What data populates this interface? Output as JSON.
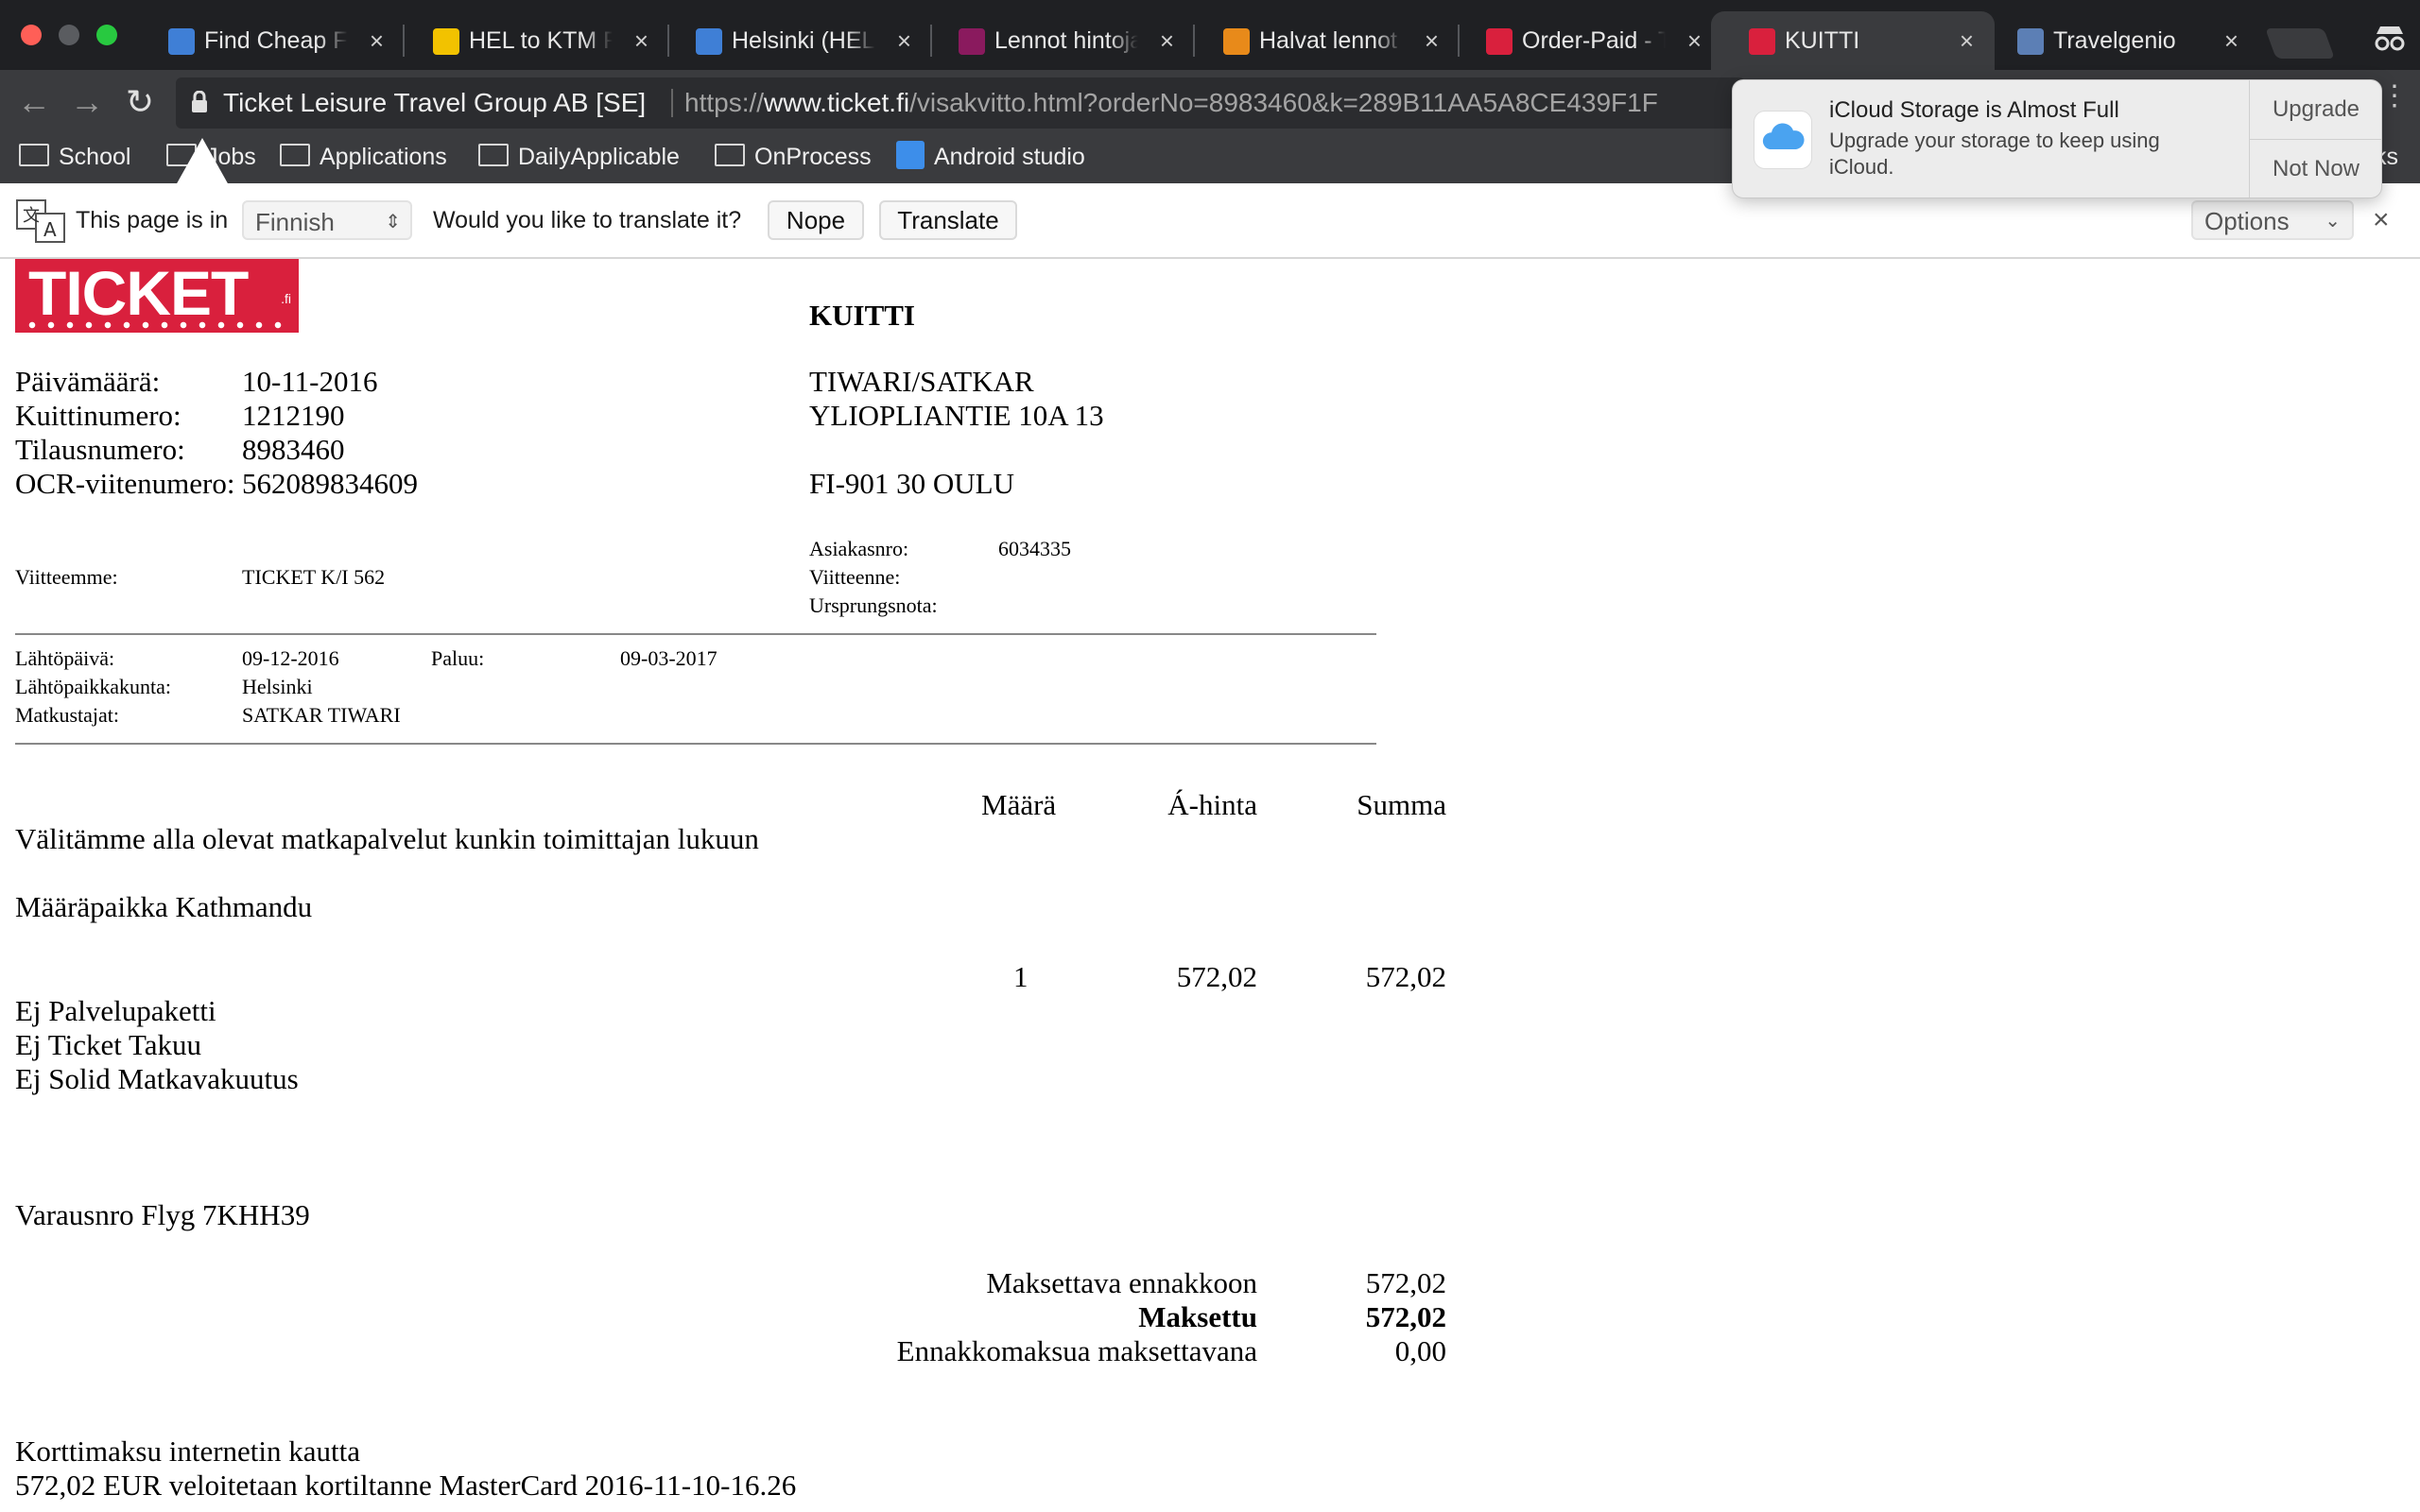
{
  "browser": {
    "tabs": [
      {
        "title": "Find Cheap Flig",
        "favicon_color": "#3f7fd6"
      },
      {
        "title": "HEL to KTM Flig",
        "favicon_color": "#f2c200"
      },
      {
        "title": "Helsinki (HEL) t",
        "favicon_color": "#3f7fd6"
      },
      {
        "title": "Lennot hintoja",
        "favicon_color": "#8a1a5e"
      },
      {
        "title": "Halvat lennot –",
        "favicon_color": "#e88a1a"
      },
      {
        "title": "Order-Paid - Ti",
        "favicon_color": "#d9203d"
      },
      {
        "title": "KUITTI",
        "favicon_color": "#d9203d",
        "active": true
      },
      {
        "title": "Travelgenio",
        "favicon_color": "#5c7fb5"
      }
    ],
    "tab_close_glyph": "×",
    "nav": {
      "back": "←",
      "forward": "→",
      "reload": "↻"
    },
    "omnibox": {
      "site_name": "Ticket Leisure Travel Group AB [SE]",
      "url_scheme": "https://",
      "url_host": "www.ticket.fi",
      "url_rest": "/visakvitto.html?orderNo=8983460&k=289B11AA5A8CE439F1F"
    },
    "bookmarks": [
      {
        "label": "School",
        "icon": "folder-icon"
      },
      {
        "label": "Jobs",
        "icon": "folder-icon"
      },
      {
        "label": "Applications",
        "icon": "folder-icon"
      },
      {
        "label": "DailyApplicable",
        "icon": "folder-icon"
      },
      {
        "label": "OnProcess",
        "icon": "folder-icon"
      },
      {
        "label": "Android studio",
        "icon": "android-studio-icon"
      }
    ],
    "bookmarks_overflow": "ks"
  },
  "translate_bar": {
    "prefix": "This page is in",
    "language": "Finnish",
    "question": "Would you like to translate it?",
    "nope": "Nope",
    "translate": "Translate",
    "options": "Options",
    "close": "×"
  },
  "notification": {
    "title": "iCloud Storage is Almost Full",
    "body": "Upgrade your storage to keep using iCloud.",
    "upgrade": "Upgrade",
    "not_now": "Not Now"
  },
  "receipt": {
    "heading": "KUITTI",
    "logo_text": "TICKET",
    "logo_suffix": ".fi",
    "meta": [
      {
        "label": "Päivämäärä:",
        "value": "10-11-2016"
      },
      {
        "label": "Kuittinumero:",
        "value": "1212190"
      },
      {
        "label": "Tilausnumero:",
        "value": "8983460"
      },
      {
        "label": "OCR-viitenumero:",
        "value": "562089834609"
      }
    ],
    "address": [
      "TIWARI/SATKAR",
      "YLIOPLIANTIE 10A 13",
      "FI-901 30 OULU"
    ],
    "our_ref_label": "Viitteemme:",
    "our_ref_value": "TICKET K/I 562",
    "customer_no_label": "Asiakasnro:",
    "customer_no_value": "6034335",
    "your_ref_label": "Viitteenne:",
    "origin_label": "Ursprungsnota:",
    "trip": {
      "departure_label": "Lähtöpäivä:",
      "departure_value": "09-12-2016",
      "return_label": "Paluu:",
      "return_value": "09-03-2017",
      "from_label": "Lähtöpaikkakunta:",
      "from_value": "Helsinki",
      "travellers_label": "Matkustajat:",
      "travellers_value": "SATKAR TIWARI"
    },
    "columns": {
      "qty": "Määrä",
      "unit_price": "Á-hinta",
      "sum": "Summa"
    },
    "intro": "Välitämme alla olevat matkapalvelut kunkin toimittajan lukuun",
    "destination": "Määräpaikka Kathmandu",
    "line": {
      "qty": "1",
      "unit_price": "572,02",
      "sum": "572,02"
    },
    "extras": [
      "Ej Palvelupaketti",
      "Ej Ticket Takuu",
      "Ej Solid Matkavakuutus"
    ],
    "booking_ref": "Varausnro Flyg 7KHH39",
    "totals": [
      {
        "label": "Maksettava ennakkoon",
        "value": "572,02",
        "bold": false
      },
      {
        "label": "Maksettu",
        "value": "572,02",
        "bold": true
      },
      {
        "label": "Ennakkomaksua maksettavana",
        "value": "0,00",
        "bold": false
      }
    ],
    "payment_method": "Korttimaksu internetin kautta",
    "payment_detail": "572,02 EUR veloitetaan kortiltanne MasterCard 2016-11-10-16.26"
  }
}
